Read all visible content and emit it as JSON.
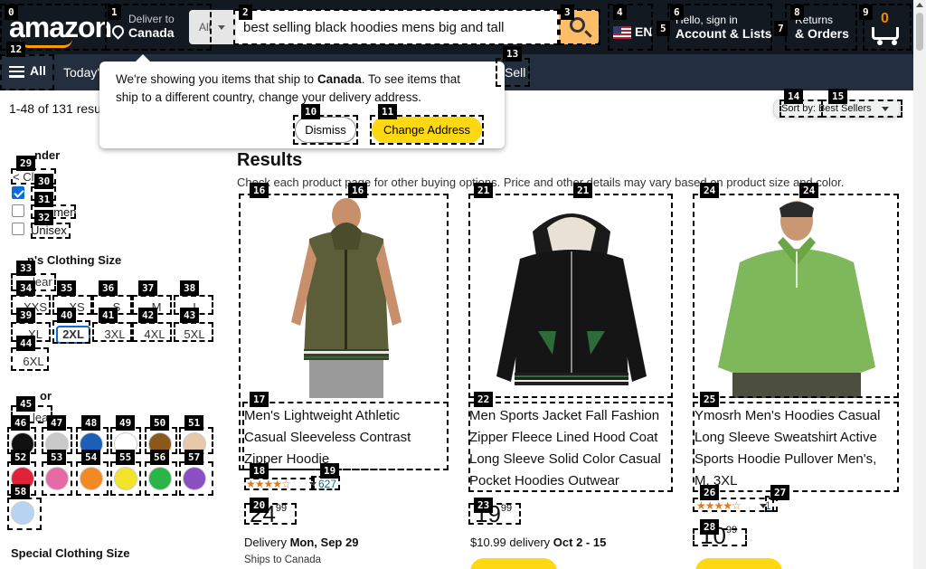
{
  "header": {
    "logo": "amazon",
    "deliver_to_label": "Deliver to",
    "deliver_to_country": "Canada",
    "search_category": "All",
    "search_value": "best selling black hoodies mens big and tall",
    "language": "EN",
    "account_line1": "Hello, sign in",
    "account_line2": "Account & Lists",
    "returns_line1": "Returns",
    "returns_line2": "& Orders",
    "cart_count": "0"
  },
  "subnav": {
    "all_label": "All",
    "today_label": "Today'",
    "sell_label": "Sell"
  },
  "popover": {
    "line1_prefix": "We're showing you items that ship to ",
    "line1_country": "Canada",
    "line1_suffix": ". To see items that",
    "line2": "ship to a different country, change your delivery address.",
    "dismiss_label": "Dismiss",
    "change_label": "Change Address"
  },
  "results_bar": {
    "count_text": "1-48 of 131 resu",
    "sort_label": "Sort by:",
    "sort_value": "Best Sellers"
  },
  "sidebar": {
    "gender_heading": "nder",
    "gender_clear": "< Cl",
    "gender_options": [
      {
        "label": "",
        "checked": true
      },
      {
        "label": "omen",
        "checked": false
      },
      {
        "label": "Unisex",
        "checked": false
      }
    ],
    "size_heading": "n's Clothing Size",
    "size_clear": "lear",
    "sizes": [
      "XXS",
      "XS",
      "S",
      "M",
      "L",
      "XL",
      "2XL",
      "3XL",
      "4XL",
      "5XL",
      "6XL"
    ],
    "selected_size": "2XL",
    "color_heading": "or",
    "color_clear": "lear",
    "swatch_colors": [
      "#111111",
      "#c9c9c9",
      "#1c5fb8",
      "#ffffff",
      "#8a5a1c",
      "#e6c9a8",
      "#e0233a",
      "#e66aa6",
      "#f28a24",
      "#f2e22a",
      "#2bb548",
      "#8a4fc0",
      "#b9d3f2"
    ],
    "special_heading": "Special Clothing Size"
  },
  "results": {
    "heading": "Results",
    "sub": "Check each product page for other buying options. Price and other details may vary based on product size and color."
  },
  "products": [
    {
      "title_lines": [
        "Men's Lightweight Athletic",
        "Casual Sleeveless Contrast",
        "Zipper Hoodie"
      ],
      "stars": "★★★★☆",
      "rating_count": "627",
      "price_whole": "24",
      "price_frac": "99",
      "delivery_label": "Delivery",
      "delivery_date": "Mon, Sep 29",
      "ships": "Ships to Canada"
    },
    {
      "title_lines": [
        "Men Sports Jacket Fall Fashion",
        "Zipper Fleece Lined Hood Coat",
        "Long Sleeve Solid Color Casual",
        "Pocket Hoodies Outwear"
      ],
      "price_whole": "19",
      "price_frac": "99",
      "delivery_price": "$10.99 delivery",
      "delivery_date": "Oct 2 - 15"
    },
    {
      "title_lines": [
        "Ymosrh Men's Hoodies Casual",
        "Long Sleeve Sweatshirt Active",
        "Sports Hoodie Pullover Men's,",
        "M, 3XL"
      ],
      "stars": "★★★★☆",
      "rating_count": "1",
      "price_whole": "10",
      "price_frac": "99"
    }
  ],
  "markers": [
    "0",
    "1",
    "2",
    "3",
    "4",
    "5",
    "6",
    "7",
    "8",
    "9",
    "10",
    "11",
    "12",
    "13",
    "14",
    "15",
    "16",
    "16",
    "17",
    "18",
    "19",
    "20",
    "21",
    "21",
    "22",
    "23",
    "24",
    "24",
    "25",
    "26",
    "27",
    "28",
    "29",
    "30",
    "31",
    "32",
    "33",
    "34",
    "35",
    "36",
    "37",
    "38",
    "39",
    "40",
    "41",
    "42",
    "43",
    "44",
    "45",
    "46",
    "47",
    "48",
    "49",
    "50",
    "51",
    "52",
    "53",
    "54",
    "55",
    "56",
    "57",
    "58"
  ],
  "colors": {
    "nav_dark": "#131921",
    "nav_sub": "#232f3e",
    "accent_orange": "#febd69",
    "button_yellow": "#ffd814",
    "link_teal": "#007185"
  }
}
